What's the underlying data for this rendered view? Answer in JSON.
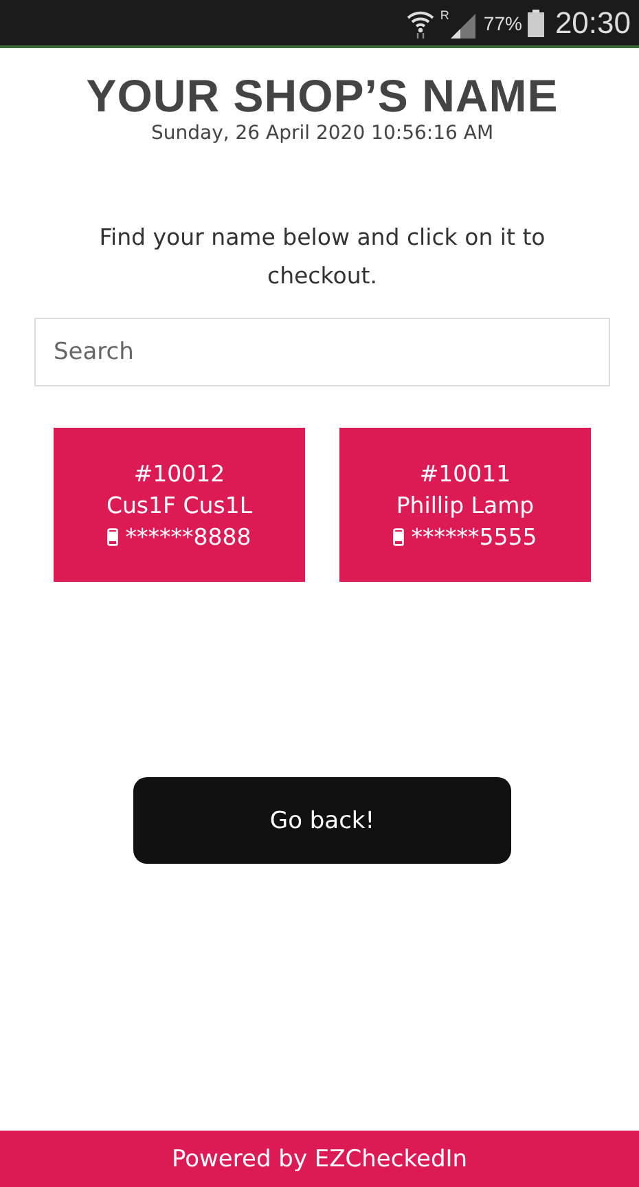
{
  "status_bar": {
    "roaming": "R",
    "battery": "77%",
    "time": "20:30"
  },
  "shop_name": "YOUR SHOP’S NAME",
  "datetime": "Sunday, 26 April 2020 10:56:16 AM",
  "instruction": "Find your name below and click on it to checkout.",
  "search": {
    "placeholder": "Search"
  },
  "customers": [
    {
      "number": "#10012",
      "name": "Cus1F Cus1L",
      "phone": "******8888"
    },
    {
      "number": "#10011",
      "name": "Phillip Lamp",
      "phone": "******5555"
    }
  ],
  "back_button": "Go back!",
  "footer": "Powered by EZCheckedIn"
}
